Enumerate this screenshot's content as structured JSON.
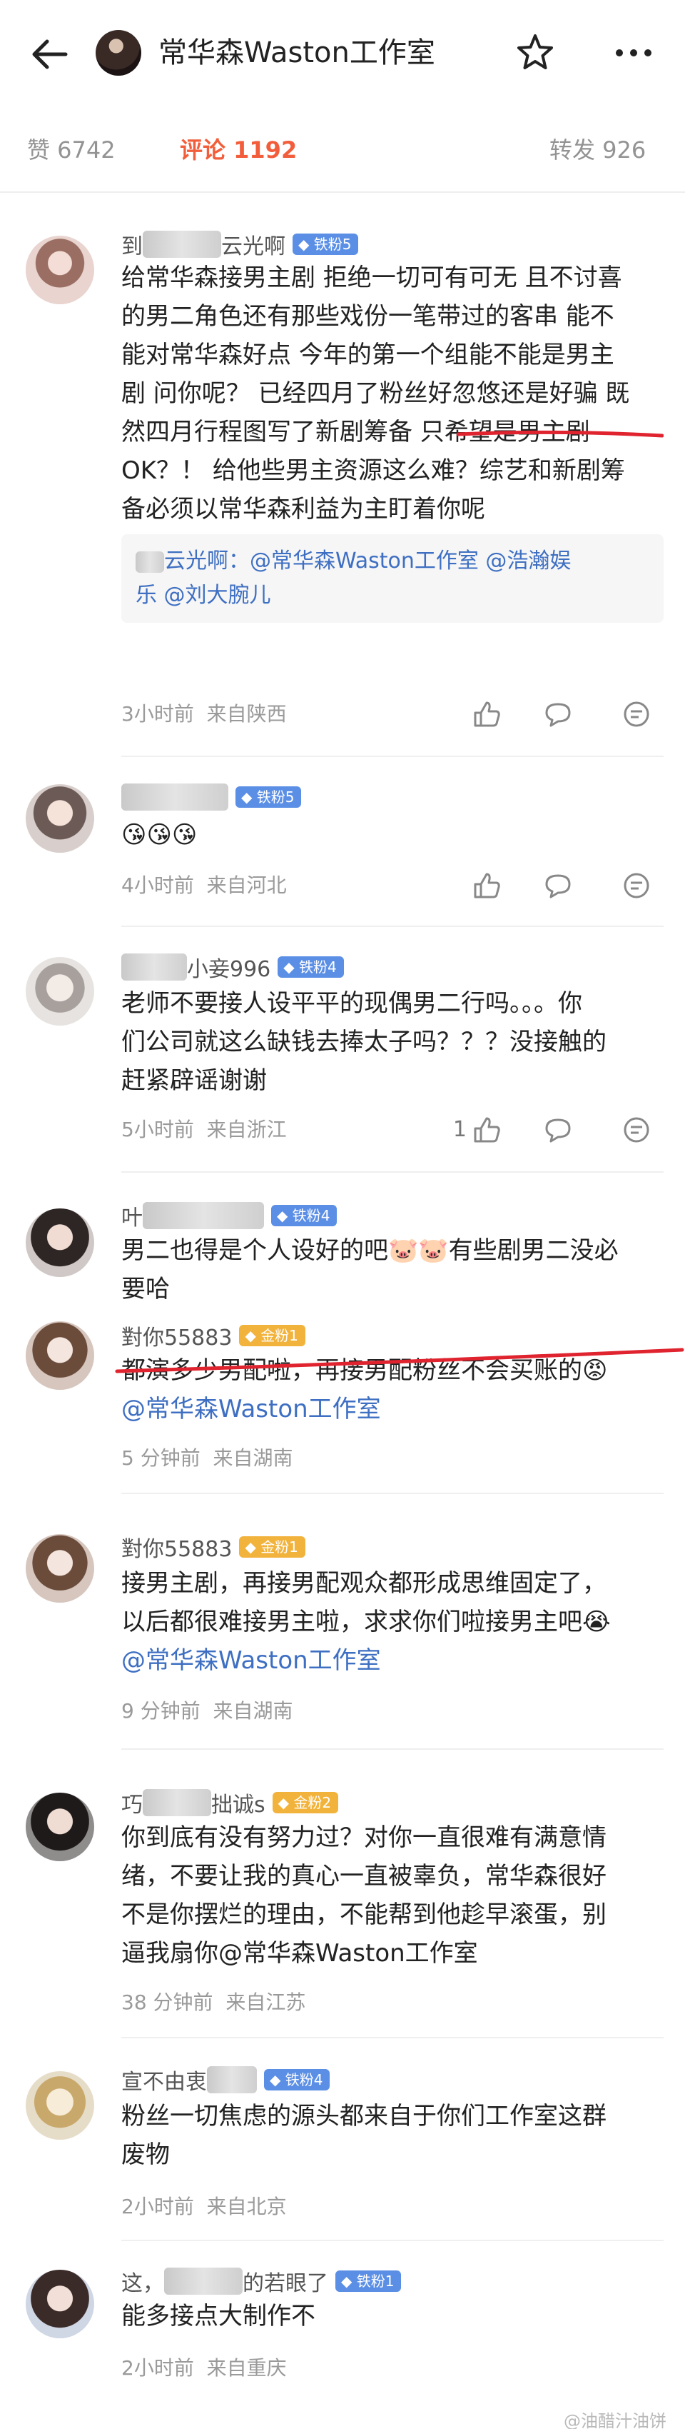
{
  "header": {
    "title": "常华森Waston工作室",
    "back_icon": "arrow-left-icon",
    "star_icon": "star-outline-icon",
    "more_icon": "more-dots-icon"
  },
  "tabs": [
    {
      "label": "赞 6742",
      "active": false
    },
    {
      "label": "评论 1192",
      "active": true
    },
    {
      "label": "转发 926",
      "active": false
    }
  ],
  "colors": {
    "accent": "#f25e3b",
    "link": "#3e6fc2",
    "badge_blue": "#5b8fe6",
    "badge_gold": "#f2b33d"
  },
  "comments": [
    {
      "name_visible": "到",
      "name_tail": "云光啊",
      "badge": "铁粉5",
      "lines": [
        "给常华森接男主剧 拒绝一切可有可无 且不讨喜",
        "的男二角色还有那些戏份一笔带过的客串 能不",
        "能对常华森好点 今年的第一个组能不能是男主",
        "剧 问你呢？ 已经四月了粉丝好忽悠还是好骗 既",
        "然四月行程图写了新剧筹备 只希望是男主剧",
        "OK？！ 给他些男主资源这么难？综艺和新剧筹",
        "备必须以常华森利益为主盯着你呢"
      ],
      "quote": {
        "prefix": "云光啊：",
        "mentions": "@常华森Waston工作室 @浩瀚娱",
        "mentions2": "乐 @刘大腕儿"
      },
      "time": "3小时前",
      "location": "来自陕西",
      "likes": ""
    },
    {
      "name_visible": "",
      "badge": "铁粉5",
      "lines": [
        "😘😘😘"
      ],
      "time": "4小时前",
      "location": "来自河北",
      "likes": ""
    },
    {
      "name_visible": "小妾996",
      "badge": "铁粉4",
      "lines": [
        "老师不要接人设平平的现偶男二行吗。。。你",
        "们公司就这么缺钱去捧太子吗？？？没接触的",
        "赶紧辟谣谢谢"
      ],
      "time": "5小时前",
      "location": "来自浙江",
      "likes": "1"
    },
    {
      "name_visible": "叶",
      "badge": "铁粉4",
      "lines": [
        "男二也得是个人设好的吧🐷🐷有些剧男二没必",
        "要哈"
      ],
      "time": "",
      "location": "",
      "likes": ""
    },
    {
      "name_visible": "對你55883",
      "badge": "金粉1",
      "lines": [
        "都演多少男配啦，再接男配粉丝不会买账的😡",
        "@常华森Waston工作室"
      ],
      "time": "5 分钟前",
      "location": "来自湖南",
      "likes": ""
    },
    {
      "name_visible": "對你55883",
      "badge": "金粉1",
      "lines": [
        "接男主剧，再接男配观众都形成思维固定了，",
        "以后都很难接男主啦，求求你们啦接男主吧😭",
        "@常华森Waston工作室"
      ],
      "time": "9 分钟前",
      "location": "来自湖南",
      "likes": ""
    },
    {
      "name_visible": "巧",
      "name_tail": "拙诚s",
      "badge": "金粉2",
      "lines": [
        "你到底有没有努力过？对你一直很难有满意情",
        "绪，不要让我的真心一直被辜负，常华森很好",
        "不是你摆烂的理由，不能帮到他趁早滚蛋，别",
        "逼我扇你@常华森Waston工作室"
      ],
      "time": "38 分钟前",
      "location": "来自江苏",
      "likes": ""
    },
    {
      "name_visible": "宣不由衷",
      "badge": "铁粉4",
      "lines": [
        "粉丝一切焦虑的源头都来自于你们工作室这群",
        "废物"
      ],
      "time": "2小时前",
      "location": "来自北京",
      "likes": ""
    },
    {
      "name_visible": "这，",
      "name_tail": "的若眼了",
      "badge": "铁粉1",
      "lines": [
        "能多接点大制作不"
      ],
      "time": "2小时前",
      "location": "来自重庆",
      "likes": ""
    }
  ],
  "icons": {
    "like": "thumbs-up-icon",
    "comment": "comment-bubble-icon",
    "badge": "fan-badge-icon"
  },
  "watermark": "@油醋汁油饼"
}
